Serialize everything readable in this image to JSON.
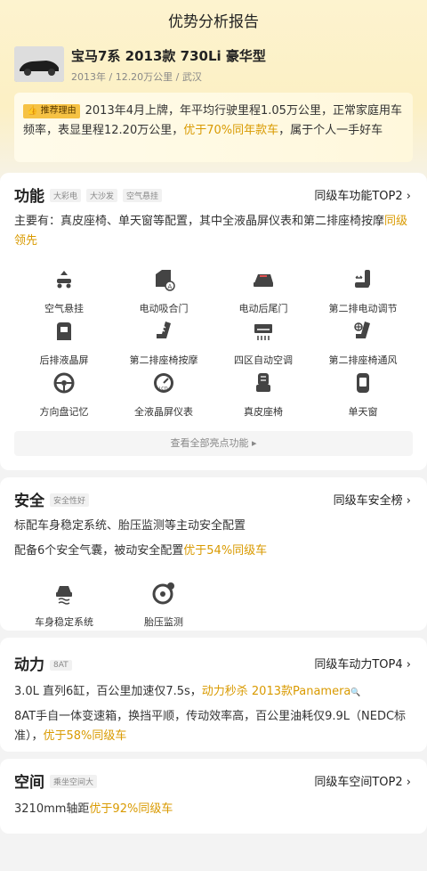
{
  "page_title": "优势分析报告",
  "car": {
    "name": "宝马7系 2013款 730Li 豪华型",
    "sub": "2013年 / 12.20万公里 / 武汉"
  },
  "reason": {
    "tag": "推荐理由",
    "text_before": "2013年4月上牌，年平均行驶里程1.05万公里，正常家庭用车频率，表显里程12.20万公里，",
    "highlight": "优于70%同年款车",
    "text_after": "，属于个人一手好车"
  },
  "function": {
    "title": "功能",
    "badges": [
      "大彩电",
      "大沙发",
      "空气悬挂"
    ],
    "rank": "同级车功能TOP2",
    "desc_before": "主要有：真皮座椅、单天窗等配置，其中全液晶屏仪表和第二排座椅按摩",
    "desc_highlight": "同级领先",
    "features": [
      {
        "label": "空气悬挂",
        "icon": "air-suspension-icon"
      },
      {
        "label": "电动吸合门",
        "icon": "soft-close-door-icon"
      },
      {
        "label": "电动后尾门",
        "icon": "power-tailgate-icon"
      },
      {
        "label": "第二排电动调节",
        "icon": "seat-adjust-icon"
      },
      {
        "label": "后排液晶屏",
        "icon": "rear-screen-icon"
      },
      {
        "label": "第二排座椅按摩",
        "icon": "seat-massage-icon"
      },
      {
        "label": "四区自动空调",
        "icon": "climate-icon"
      },
      {
        "label": "第二排座椅通风",
        "icon": "seat-vent-icon"
      },
      {
        "label": "方向盘记忆",
        "icon": "steering-memory-icon"
      },
      {
        "label": "全液晶屏仪表",
        "icon": "lcd-cluster-icon"
      },
      {
        "label": "真皮座椅",
        "icon": "leather-seat-icon"
      },
      {
        "label": "单天窗",
        "icon": "sunroof-icon"
      }
    ],
    "see_all": "查看全部亮点功能"
  },
  "safety": {
    "title": "安全",
    "badge": "安全性好",
    "rank": "同级车安全榜",
    "line1": "标配车身稳定系统、胎压监测等主动安全配置",
    "line2_before": "配备6个安全气囊，被动安全配置",
    "line2_highlight": "优于54%同级车",
    "features": [
      {
        "label": "车身稳定系统",
        "icon": "stability-icon"
      },
      {
        "label": "胎压监测",
        "icon": "tire-pressure-icon"
      }
    ]
  },
  "power": {
    "title": "动力",
    "badge": "8AT",
    "rank": "同级车动力TOP4",
    "line1_before": "3.0L 直列6缸，百公里加速仅7.5s，",
    "line1_highlight": "动力秒杀 2013款Panamera",
    "line2_before": "8AT手自一体变速箱，换挡平顺，传动效率高，百公里油耗仅9.9L（NEDC标准），",
    "line2_highlight": "优于58%同级车"
  },
  "space": {
    "title": "空间",
    "badge": "乘坐空间大",
    "rank": "同级车空间TOP2",
    "line_before": "3210mm轴距",
    "line_highlight": "优于92%同级车"
  }
}
